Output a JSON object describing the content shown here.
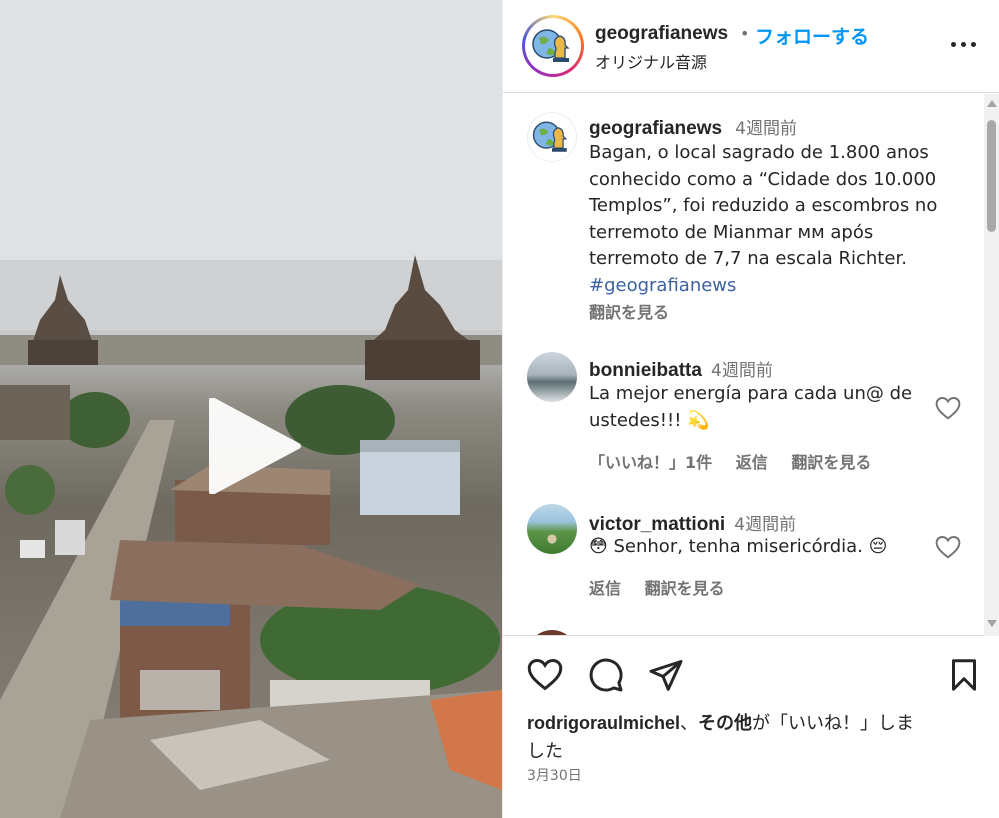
{
  "post": {
    "username": "geografianews",
    "separator": "•",
    "follow_label": "フォローする",
    "audio_label": "オリジナル音源"
  },
  "caption": {
    "username": "geografianews",
    "time": "4週間前",
    "lines": [
      "Bagan, o local sagrado de 1.800 anos",
      "conhecido como a “Cidade dos 10.000",
      "Templos”, foi reduzido a escombros no",
      "terremoto de Mianmar мм após",
      "terremoto de 7,7 na escala Richter."
    ],
    "hashtag": "#geografianews",
    "translate_label": "翻訳を見る"
  },
  "comments": [
    {
      "username": "bonnieibatta",
      "time": "4週間前",
      "lines": [
        "La mejor energía para cada un@ de",
        "ustedes!!! 💫"
      ],
      "likes_label": "「いいね！」1件",
      "reply_label": "返信",
      "translate_label": "翻訳を見る"
    },
    {
      "username": "victor_mattioni",
      "time": "4週間前",
      "lines": [
        "😳 Senhor, tenha misericórdia. 😔"
      ],
      "reply_label": "返信",
      "translate_label": "翻訳を見る"
    }
  ],
  "likes": {
    "user": "rodrigoraulmichel",
    "sep": "、",
    "others": "その他",
    "line1_rest": "が「いいね！」しま",
    "line2": "した"
  },
  "date": "3月30日",
  "colors": {
    "accent": "#0095f6",
    "text": "#262626",
    "secondary": "#737373",
    "hashtag": "#3c62a0"
  },
  "icons": {
    "like": "heart-icon",
    "comment": "comment-icon",
    "share": "paper-plane-icon",
    "save": "bookmark-icon",
    "more": "more-options-icon",
    "play": "play-icon"
  }
}
